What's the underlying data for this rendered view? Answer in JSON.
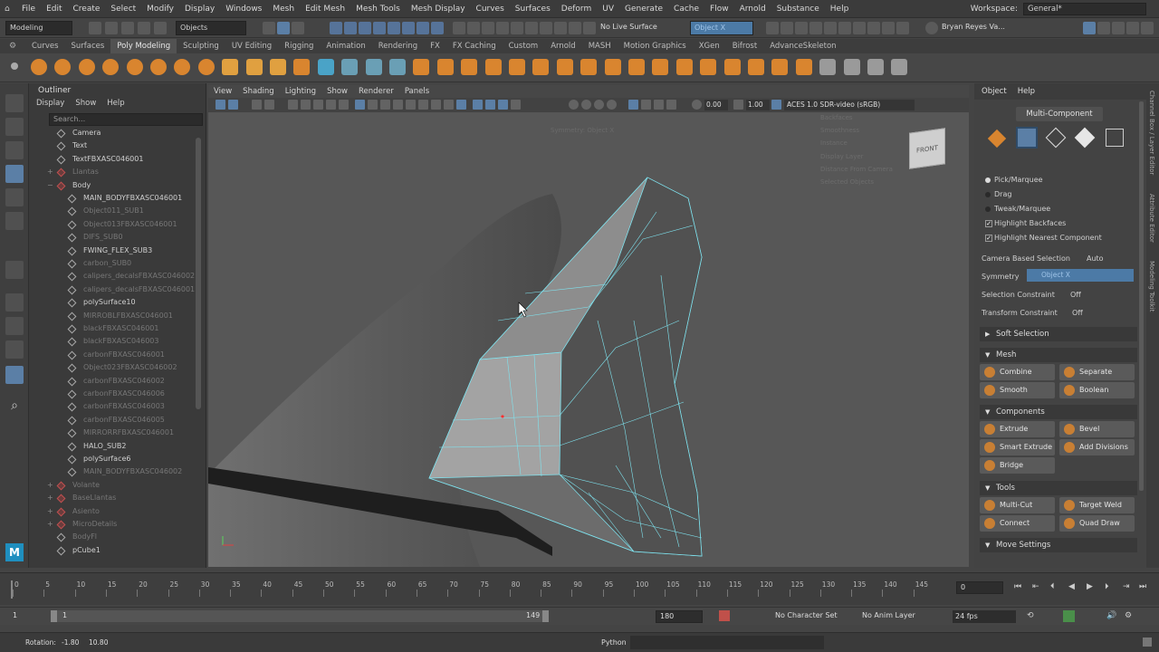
{
  "menubar": {
    "items": [
      "File",
      "Edit",
      "Create",
      "Select",
      "Modify",
      "Display",
      "Windows",
      "Mesh",
      "Edit Mesh",
      "Mesh Tools",
      "Mesh Display",
      "Curves",
      "Surfaces",
      "Deform",
      "UV",
      "Generate",
      "Cache",
      "Flow",
      "Arnold",
      "Substance",
      "Help"
    ],
    "workspace_label": "Workspace:",
    "workspace_value": "General*"
  },
  "statusline": {
    "mode": "Modeling",
    "objects": "Objects",
    "live_surface": "No Live Surface",
    "symmetry": "Object X",
    "user": "Bryan Reyes Va..."
  },
  "shelf_tabs": [
    "Curves",
    "Surfaces",
    "Poly Modeling",
    "Sculpting",
    "UV Editing",
    "Rigging",
    "Animation",
    "Rendering",
    "FX",
    "FX Caching",
    "Custom",
    "Arnold",
    "MASH",
    "Motion Graphics",
    "XGen",
    "Bifrost",
    "AdvanceSkeleton"
  ],
  "shelf_active": "Poly Modeling",
  "shelf_icon_colors": [
    "#d9852f",
    "#d9852f",
    "#d9852f",
    "#d9852f",
    "#d9852f",
    "#d9852f",
    "#d9852f",
    "#d9852f",
    "#e0a040",
    "#e0a040",
    "#e0a040",
    "#d9852f",
    "#4aa3c7",
    "#6a9fb5",
    "#6a9fb5",
    "#6a9fb5",
    "#d9852f",
    "#d9852f",
    "#d9852f",
    "#d9852f",
    "#d9852f",
    "#d9852f",
    "#d9852f",
    "#d9852f",
    "#d9852f",
    "#d9852f",
    "#d9852f",
    "#d9852f",
    "#d9852f",
    "#d9852f",
    "#d9852f",
    "#d9852f",
    "#d9852f",
    "#9a9a9a",
    "#9a9a9a",
    "#9a9a9a",
    "#9a9a9a"
  ],
  "outliner": {
    "title": "Outliner",
    "menu": [
      "Display",
      "Show",
      "Help"
    ],
    "search_placeholder": "Search...",
    "rows": [
      {
        "label": "Camera",
        "indent": 1,
        "dim": false,
        "group": false,
        "expand": ""
      },
      {
        "label": "Text",
        "indent": 1,
        "dim": false,
        "group": false,
        "expand": ""
      },
      {
        "label": "TextFBXASC046001",
        "indent": 1,
        "dim": false,
        "group": false,
        "expand": ""
      },
      {
        "label": "Llantas",
        "indent": 1,
        "dim": true,
        "group": true,
        "expand": "+"
      },
      {
        "label": "Body",
        "indent": 1,
        "dim": false,
        "group": true,
        "expand": "−"
      },
      {
        "label": "MAIN_BODYFBXASC046001",
        "indent": 2,
        "dim": false,
        "group": false,
        "expand": ""
      },
      {
        "label": "Object011_SUB1",
        "indent": 2,
        "dim": true,
        "group": false,
        "expand": ""
      },
      {
        "label": "Object013FBXASC046001",
        "indent": 2,
        "dim": true,
        "group": false,
        "expand": ""
      },
      {
        "label": "DIFS_SUB0",
        "indent": 2,
        "dim": true,
        "group": false,
        "expand": ""
      },
      {
        "label": "FWING_FLEX_SUB3",
        "indent": 2,
        "dim": false,
        "group": false,
        "expand": ""
      },
      {
        "label": "carbon_SUB0",
        "indent": 2,
        "dim": true,
        "group": false,
        "expand": ""
      },
      {
        "label": "calipers_decalsFBXASC046002",
        "indent": 2,
        "dim": true,
        "group": false,
        "expand": ""
      },
      {
        "label": "calipers_decalsFBXASC046001",
        "indent": 2,
        "dim": true,
        "group": false,
        "expand": ""
      },
      {
        "label": "polySurface10",
        "indent": 2,
        "dim": false,
        "group": false,
        "expand": ""
      },
      {
        "label": "MIRROBLFBXASC046001",
        "indent": 2,
        "dim": true,
        "group": false,
        "expand": ""
      },
      {
        "label": "blackFBXASC046001",
        "indent": 2,
        "dim": true,
        "group": false,
        "expand": ""
      },
      {
        "label": "blackFBXASC046003",
        "indent": 2,
        "dim": true,
        "group": false,
        "expand": ""
      },
      {
        "label": "carbonFBXASC046001",
        "indent": 2,
        "dim": true,
        "group": false,
        "expand": ""
      },
      {
        "label": "Object023FBXASC046002",
        "indent": 2,
        "dim": true,
        "group": false,
        "expand": ""
      },
      {
        "label": "carbonFBXASC046002",
        "indent": 2,
        "dim": true,
        "group": false,
        "expand": ""
      },
      {
        "label": "carbonFBXASC046006",
        "indent": 2,
        "dim": true,
        "group": false,
        "expand": ""
      },
      {
        "label": "carbonFBXASC046003",
        "indent": 2,
        "dim": true,
        "group": false,
        "expand": ""
      },
      {
        "label": "carbonFBXASC046005",
        "indent": 2,
        "dim": true,
        "group": false,
        "expand": ""
      },
      {
        "label": "MIRRORRFBXASC046001",
        "indent": 2,
        "dim": true,
        "group": false,
        "expand": ""
      },
      {
        "label": "HALO_SUB2",
        "indent": 2,
        "dim": false,
        "group": false,
        "expand": ""
      },
      {
        "label": "polySurface6",
        "indent": 2,
        "dim": false,
        "group": false,
        "expand": ""
      },
      {
        "label": "MAIN_BODYFBXASC046002",
        "indent": 2,
        "dim": true,
        "group": false,
        "expand": ""
      },
      {
        "label": "Volante",
        "indent": 1,
        "dim": true,
        "group": true,
        "expand": "+"
      },
      {
        "label": "BaseLlantas",
        "indent": 1,
        "dim": true,
        "group": true,
        "expand": "+"
      },
      {
        "label": "Asiento",
        "indent": 1,
        "dim": true,
        "group": true,
        "expand": "+"
      },
      {
        "label": "MicroDetails",
        "indent": 1,
        "dim": true,
        "group": true,
        "expand": "+"
      },
      {
        "label": "BodyFl",
        "indent": 1,
        "dim": true,
        "group": false,
        "expand": ""
      },
      {
        "label": "pCube1",
        "indent": 1,
        "dim": false,
        "group": false,
        "expand": ""
      }
    ]
  },
  "viewport": {
    "menu": [
      "View",
      "Shading",
      "Lighting",
      "Show",
      "Renderer",
      "Panels"
    ],
    "exposure": "0.00",
    "gamma": "1.00",
    "colorspace": "ACES 1.0 SDR-video (sRGB)",
    "symmetry_hint": "Symmetry: Object X",
    "hud_labels": [
      "Backfaces",
      "Smoothness",
      "Instance",
      "Display Layer",
      "Distance From Camera",
      "Selected Objects"
    ],
    "viewcube_label": "FRONT"
  },
  "right_panel": {
    "menu": [
      "Object",
      "Help"
    ],
    "header": "Multi-Component",
    "options": [
      {
        "type": "radio",
        "label": "Pick/Marquee",
        "on": true
      },
      {
        "type": "radio",
        "label": "Drag",
        "on": false
      },
      {
        "type": "radio",
        "label": "Tweak/Marquee",
        "on": false
      },
      {
        "type": "check",
        "label": "Highlight Backfaces",
        "on": true
      },
      {
        "type": "check",
        "label": "Highlight Nearest Component",
        "on": true
      }
    ],
    "camera_sel_label": "Camera Based Selection",
    "camera_sel_value": "Auto",
    "symmetry_label": "Symmetry",
    "symmetry_value": "Object X",
    "sel_constraint_label": "Selection Constraint",
    "sel_constraint_value": "Off",
    "xform_constraint_label": "Transform Constraint",
    "xform_constraint_value": "Off",
    "soft_selection": "Soft Selection",
    "mesh_section": "Mesh",
    "mesh_buttons": [
      "Combine",
      "Separate",
      "Smooth",
      "Boolean"
    ],
    "components_section": "Components",
    "components_buttons": [
      "Extrude",
      "Bevel",
      "Smart Extrude",
      "Add Divisions",
      "Bridge"
    ],
    "tools_section": "Tools",
    "tools_buttons": [
      "Multi-Cut",
      "Target Weld",
      "Connect",
      "Quad Draw"
    ],
    "move_settings": "Move Settings"
  },
  "side_tabs": [
    "Channel Box / Layer Editor",
    "Attribute Editor",
    "Modeling Toolkit"
  ],
  "timeline": {
    "ticks": [
      "0",
      "5",
      "10",
      "15",
      "20",
      "25",
      "30",
      "35",
      "40",
      "45",
      "50",
      "55",
      "60",
      "65",
      "70",
      "75",
      "80",
      "85",
      "90",
      "95",
      "100",
      "105",
      "110",
      "115",
      "120",
      "125",
      "130",
      "135",
      "140",
      "145"
    ],
    "current_frame": "0"
  },
  "range": {
    "start": "1",
    "inner_start": "1",
    "inner_end": "149",
    "end": "180",
    "character_set": "No Character Set",
    "anim_layer": "No Anim Layer",
    "fps": "24 fps"
  },
  "cmdline": {
    "rotation_label": "Rotation:",
    "rot_x": "-1.80",
    "rot_y": "10.80",
    "language": "Python"
  },
  "colors": {
    "accent_blue": "#5b7fa6",
    "wire_cyan": "#7fe4f0",
    "symmetry_field": "#4c7aa6"
  }
}
